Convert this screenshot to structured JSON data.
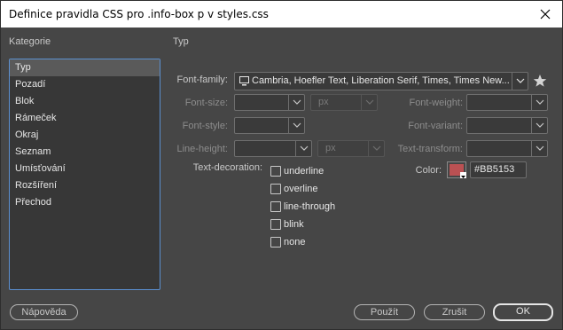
{
  "window": {
    "title": "Definice pravidla CSS pro .info-box p v styles.css"
  },
  "categories": {
    "heading": "Kategorie",
    "items": [
      "Typ",
      "Pozadí",
      "Blok",
      "Rámeček",
      "Okraj",
      "Seznam",
      "Umísťování",
      "Rozšíření",
      "Přechod"
    ],
    "selected": "Typ"
  },
  "panel": {
    "heading": "Typ"
  },
  "fields": {
    "font_family": {
      "label": "Font-family:",
      "value": "Cambria, Hoefler Text, Liberation Serif, Times, Times New..."
    },
    "font_size": {
      "label": "Font-size:",
      "unit": "px"
    },
    "font_weight": {
      "label": "Font-weight:"
    },
    "font_style": {
      "label": "Font-style:"
    },
    "font_variant": {
      "label": "Font-variant:"
    },
    "line_height": {
      "label": "Line-height:",
      "unit": "px"
    },
    "text_transform": {
      "label": "Text-transform:"
    },
    "text_decoration": {
      "label": "Text-decoration:",
      "options": [
        "underline",
        "overline",
        "line-through",
        "blink",
        "none"
      ]
    },
    "color": {
      "label": "Color:",
      "value": "#BB5153",
      "swatch": "#bb5153"
    }
  },
  "buttons": {
    "help": "Nápověda",
    "apply": "Použít",
    "cancel": "Zrušit",
    "ok": "OK"
  },
  "icons": {
    "close": "close-icon",
    "font": "monitor-font-icon",
    "favorite": "star-icon"
  }
}
